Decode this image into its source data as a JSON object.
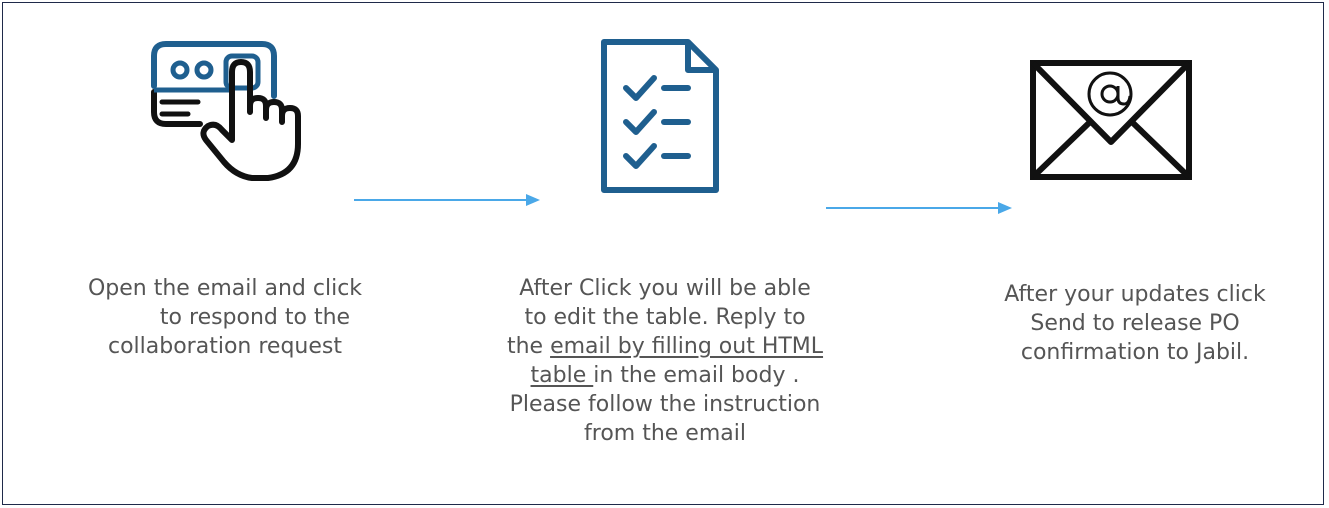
{
  "steps": [
    {
      "icon": "hand-click-card-icon",
      "lines": [
        "Open the email and click",
        "to respond to the",
        "collaboration request"
      ]
    },
    {
      "icon": "checklist-document-icon",
      "lines": [
        "After Click you will be able",
        "to edit the table. Reply to"
      ],
      "line3_prefix": "the ",
      "line3_link": "email by filling out HTML",
      "line4_link": "table ",
      "line4_suffix": "in the email body .",
      "lines_tail": [
        "Please follow the instruction",
        "from the email"
      ]
    },
    {
      "icon": "email-envelope-icon",
      "lines": [
        "After your updates click",
        "Send to release PO",
        "confirmation to Jabil."
      ]
    }
  ],
  "colors": {
    "icon_dark": "#111111",
    "icon_blue": "#1f5f8f",
    "arrow": "#4aa8e8",
    "text": "#555555",
    "border": "#1f2a4a"
  }
}
